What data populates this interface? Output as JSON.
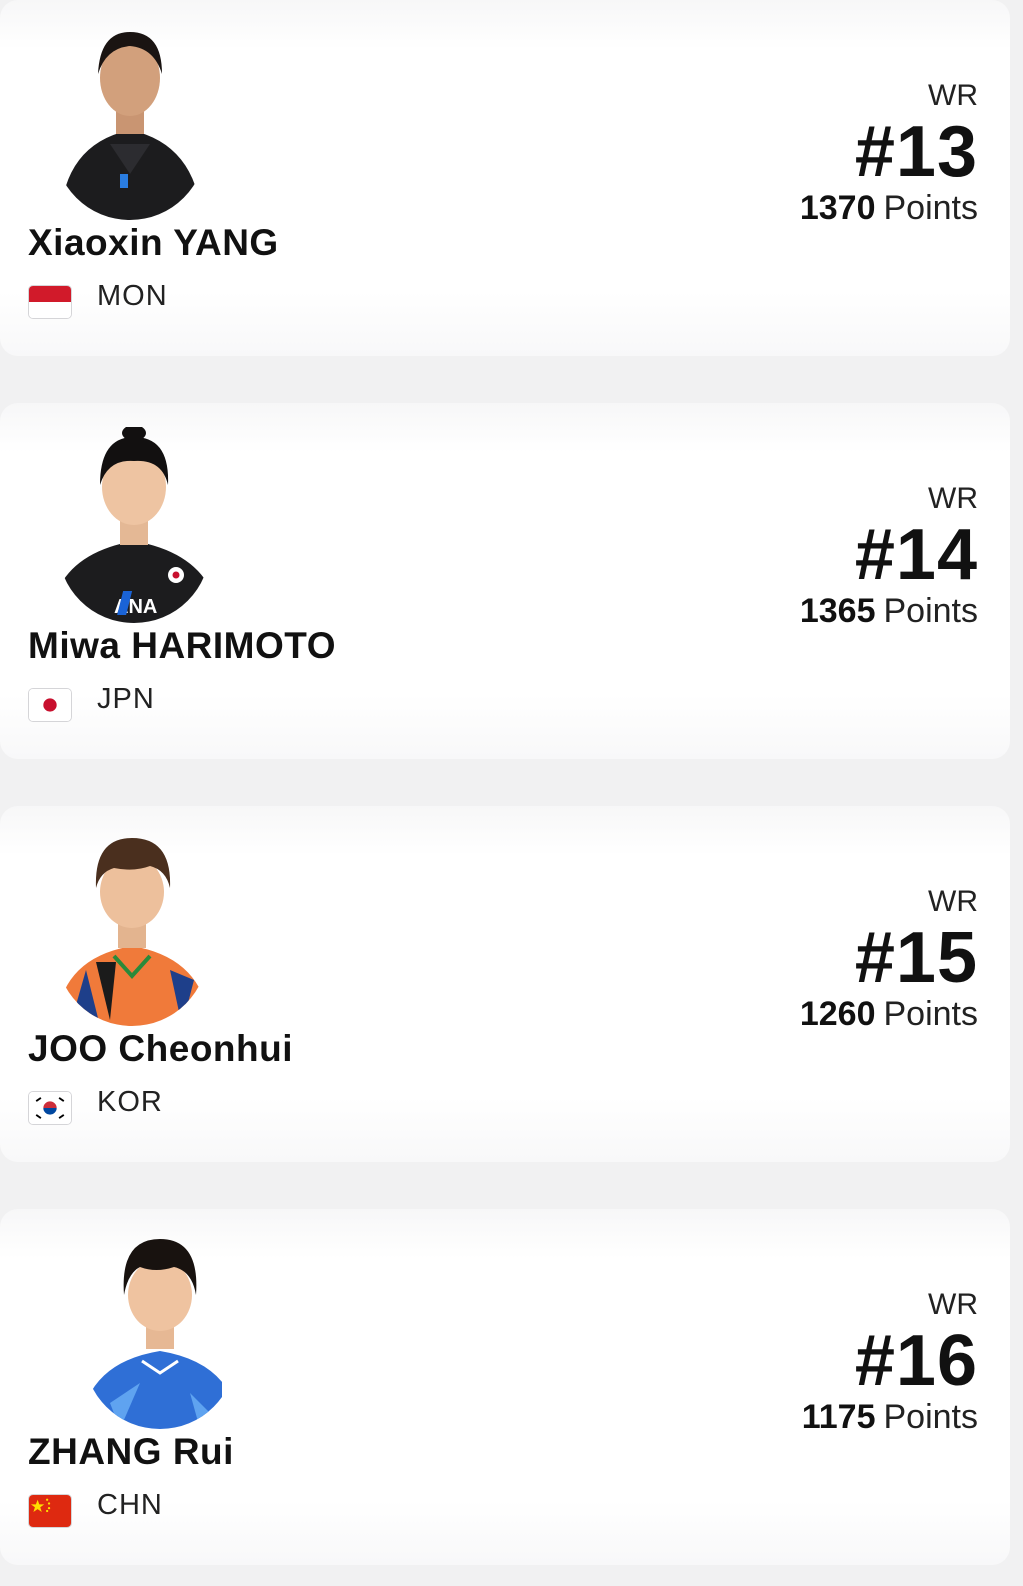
{
  "players": [
    {
      "name": "Xiaoxin YANG",
      "country": "MON",
      "flag_icon": "mongolia-flag-icon",
      "wr_label": "WR",
      "rank": "#13",
      "points": "1370",
      "points_label": "Points"
    },
    {
      "name": "Miwa HARIMOTO",
      "country": "JPN",
      "flag_icon": "japan-flag-icon",
      "wr_label": "WR",
      "rank": "#14",
      "points": "1365",
      "points_label": "Points"
    },
    {
      "name": "JOO Cheonhui",
      "country": "KOR",
      "flag_icon": "korea-flag-icon",
      "wr_label": "WR",
      "rank": "#15",
      "points": "1260",
      "points_label": "Points"
    },
    {
      "name": "ZHANG Rui",
      "country": "CHN",
      "flag_icon": "china-flag-icon",
      "wr_label": "WR",
      "rank": "#16",
      "points": "1175",
      "points_label": "Points"
    }
  ],
  "colors": {
    "page_background": "#f1f1f2",
    "card_background": "#ffffff",
    "text": "#111111"
  }
}
